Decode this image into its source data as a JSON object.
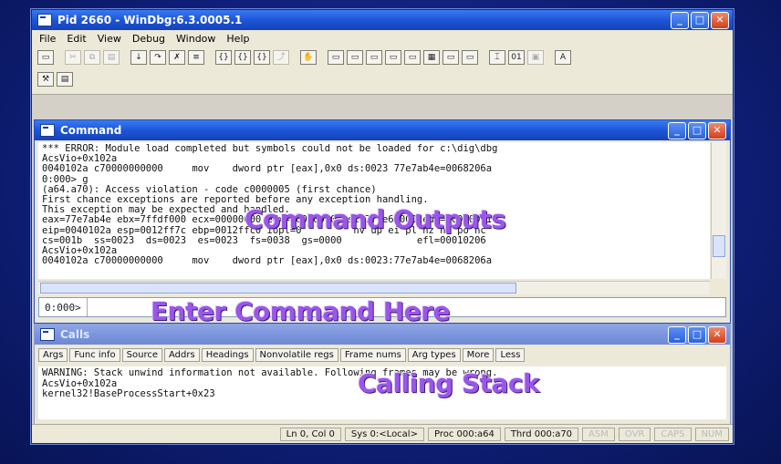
{
  "window": {
    "title": "Pid 2660 - WinDbg:6.3.0005.1",
    "controls": [
      "minimize",
      "maximize",
      "close"
    ]
  },
  "menu": [
    "File",
    "Edit",
    "View",
    "Debug",
    "Window",
    "Help"
  ],
  "toolbar": {
    "row1": [
      "open-icon",
      "cut-icon",
      "copy-icon",
      "paste-icon",
      "step-into-icon",
      "step-over-icon",
      "step-out-icon",
      "run-to-cursor-icon",
      "source-mode-icon",
      "go-icon",
      "break-icon",
      "restart-icon",
      "stop-icon",
      "watch-icon",
      "locals-icon",
      "registers-icon",
      "memory-icon",
      "call-stack-icon",
      "disassembly-icon",
      "scratch-pad-icon",
      "source-icon",
      "hex-icon",
      "options-icon",
      "font-icon"
    ],
    "row2": [
      "properties-icon",
      "window-icon"
    ]
  },
  "command": {
    "title": "Command",
    "lines": [
      "*** ERROR: Module load completed but symbols could not be loaded for c:\\dig\\dbg",
      "AcsVio+0x102a",
      "0040102a c70000000000     mov    dword ptr [eax],0x0 ds:0023 77e7ab4e=0068206a",
      "0:000> g",
      "(a64.a70): Access violation - code c0000005 (first chance)",
      "First chance exceptions are reported before any exception handling.",
      "This exception may be expected and handled.",
      "eax=77e7ab4e ebx=7ffdf000 ecx=00000000 edx=00000000 esi=7ffe60000 edi=00000001",
      "eip=0040102a esp=0012ff7c ebp=0012ffc0 iopl=0         nv up ei pl nz na po nc",
      "cs=001b  ss=0023  ds=0023  es=0023  fs=0038  gs=0000             efl=00010206",
      "AcsVio+0x102a",
      "0040102a c70000000000     mov    dword ptr [eax],0x0 ds:0023:77e7ab4e=0068206a"
    ],
    "prompt": "0:000>",
    "input_value": ""
  },
  "calls": {
    "title": "Calls",
    "buttons": [
      "Args",
      "Func info",
      "Source",
      "Addrs",
      "Headings",
      "Nonvolatile regs",
      "Frame nums",
      "Arg types",
      "More",
      "Less"
    ],
    "lines": [
      "WARNING: Stack unwind information not available. Following frames may be wrong.",
      "AcsVio+0x102a",
      "kernel32!BaseProcessStart+0x23"
    ]
  },
  "status": {
    "position": "Ln 0, Col 0",
    "sys": "Sys 0:<Local>",
    "proc": "Proc 000:a64",
    "thrd": "Thrd 000:a70",
    "asm": "ASM",
    "ovr": "OVR",
    "caps": "CAPS",
    "num": "NUM"
  },
  "annotations": {
    "command_outputs": "Command Outputs",
    "enter_command": "Enter Command Here",
    "calling_stack": "Calling Stack"
  }
}
